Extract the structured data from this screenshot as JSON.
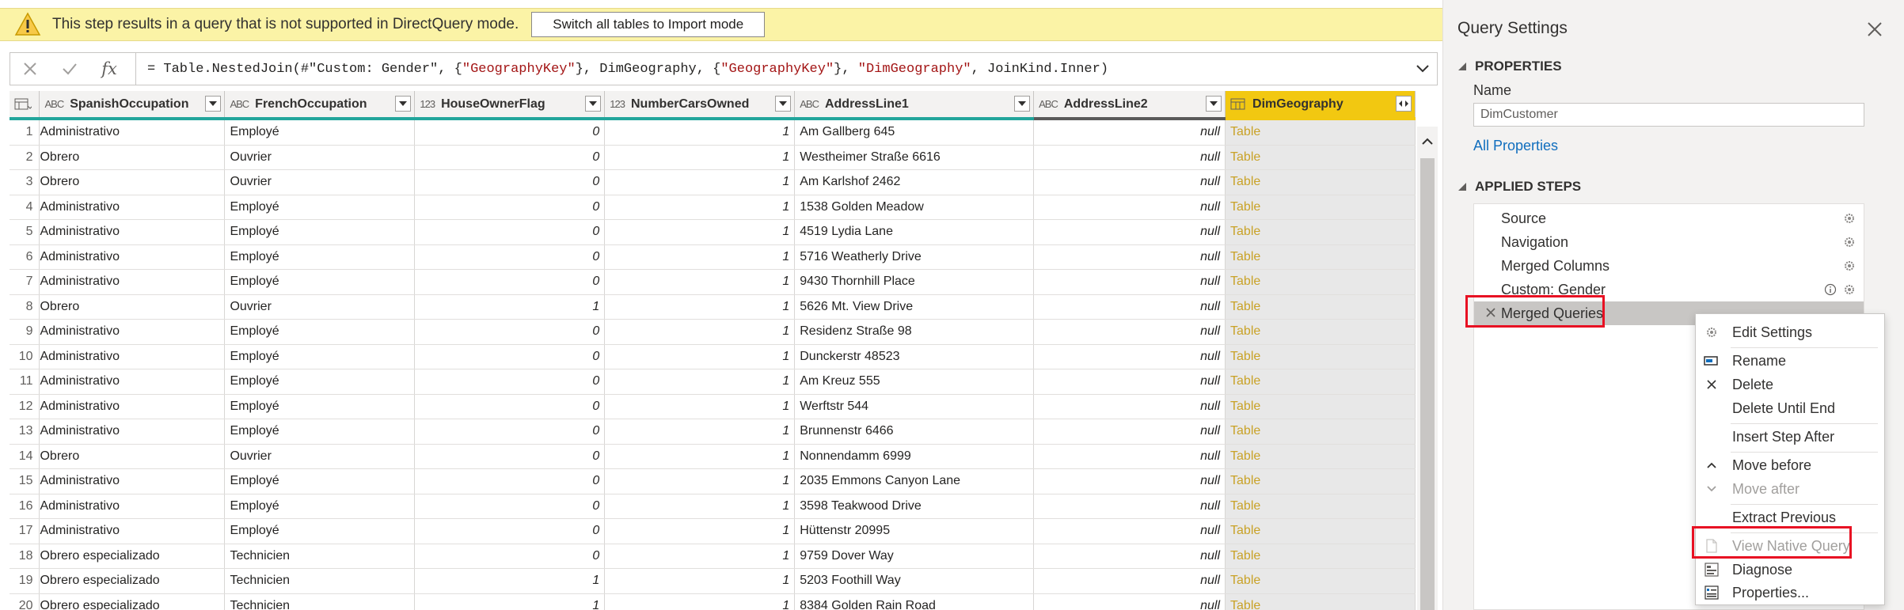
{
  "warning": {
    "message": "This step results in a query that is not supported in DirectQuery mode.",
    "button": "Switch all tables to Import mode"
  },
  "formula_bar": {
    "fx": "fx",
    "prefix": "= Table.NestedJoin(#\"Custom: Gender\", {",
    "s1": "\"GeographyKey\"",
    "mid1": "}, DimGeography, {",
    "s2": "\"GeographyKey\"",
    "mid2": "}, ",
    "s3": "\"DimGeography\"",
    "suffix": ", JoinKind.Inner)"
  },
  "columns": [
    {
      "type": "ABC",
      "name": "SpanishOccupation"
    },
    {
      "type": "ABC",
      "name": "FrenchOccupation"
    },
    {
      "type": "123",
      "name": "HouseOwnerFlag"
    },
    {
      "type": "123",
      "name": "NumberCarsOwned"
    },
    {
      "type": "ABC",
      "name": "AddressLine1"
    },
    {
      "type": "ABC",
      "name": "AddressLine2"
    },
    {
      "type": "table",
      "name": "DimGeography"
    }
  ],
  "rows": [
    {
      "n": "1",
      "sp": "Administrativo",
      "fr": "Employé",
      "ho": "0",
      "nc": "1",
      "a1": "Am Gallberg 645",
      "a2": "null",
      "dg": "Table"
    },
    {
      "n": "2",
      "sp": "Obrero",
      "fr": "Ouvrier",
      "ho": "0",
      "nc": "1",
      "a1": "Westheimer Straße 6616",
      "a2": "null",
      "dg": "Table"
    },
    {
      "n": "3",
      "sp": "Obrero",
      "fr": "Ouvrier",
      "ho": "0",
      "nc": "1",
      "a1": "Am Karlshof 2462",
      "a2": "null",
      "dg": "Table"
    },
    {
      "n": "4",
      "sp": "Administrativo",
      "fr": "Employé",
      "ho": "0",
      "nc": "1",
      "a1": "1538 Golden Meadow",
      "a2": "null",
      "dg": "Table"
    },
    {
      "n": "5",
      "sp": "Administrativo",
      "fr": "Employé",
      "ho": "0",
      "nc": "1",
      "a1": "4519 Lydia Lane",
      "a2": "null",
      "dg": "Table"
    },
    {
      "n": "6",
      "sp": "Administrativo",
      "fr": "Employé",
      "ho": "0",
      "nc": "1",
      "a1": "5716 Weatherly Drive",
      "a2": "null",
      "dg": "Table"
    },
    {
      "n": "7",
      "sp": "Administrativo",
      "fr": "Employé",
      "ho": "0",
      "nc": "1",
      "a1": "9430 Thornhill Place",
      "a2": "null",
      "dg": "Table"
    },
    {
      "n": "8",
      "sp": "Obrero",
      "fr": "Ouvrier",
      "ho": "1",
      "nc": "1",
      "a1": "5626 Mt. View Drive",
      "a2": "null",
      "dg": "Table"
    },
    {
      "n": "9",
      "sp": "Administrativo",
      "fr": "Employé",
      "ho": "0",
      "nc": "1",
      "a1": "Residenz Straße 98",
      "a2": "null",
      "dg": "Table"
    },
    {
      "n": "10",
      "sp": "Administrativo",
      "fr": "Employé",
      "ho": "0",
      "nc": "1",
      "a1": "Dunckerstr 48523",
      "a2": "null",
      "dg": "Table"
    },
    {
      "n": "11",
      "sp": "Administrativo",
      "fr": "Employé",
      "ho": "0",
      "nc": "1",
      "a1": "Am Kreuz 555",
      "a2": "null",
      "dg": "Table"
    },
    {
      "n": "12",
      "sp": "Administrativo",
      "fr": "Employé",
      "ho": "0",
      "nc": "1",
      "a1": "Werftstr 544",
      "a2": "null",
      "dg": "Table"
    },
    {
      "n": "13",
      "sp": "Administrativo",
      "fr": "Employé",
      "ho": "0",
      "nc": "1",
      "a1": "Brunnenstr 6466",
      "a2": "null",
      "dg": "Table"
    },
    {
      "n": "14",
      "sp": "Obrero",
      "fr": "Ouvrier",
      "ho": "0",
      "nc": "1",
      "a1": "Nonnendamm 6999",
      "a2": "null",
      "dg": "Table"
    },
    {
      "n": "15",
      "sp": "Administrativo",
      "fr": "Employé",
      "ho": "0",
      "nc": "1",
      "a1": "2035 Emmons Canyon Lane",
      "a2": "null",
      "dg": "Table"
    },
    {
      "n": "16",
      "sp": "Administrativo",
      "fr": "Employé",
      "ho": "0",
      "nc": "1",
      "a1": "3598 Teakwood Drive",
      "a2": "null",
      "dg": "Table"
    },
    {
      "n": "17",
      "sp": "Administrativo",
      "fr": "Employé",
      "ho": "0",
      "nc": "1",
      "a1": "Hüttenstr 20995",
      "a2": "null",
      "dg": "Table"
    },
    {
      "n": "18",
      "sp": "Obrero especializado",
      "fr": "Technicien",
      "ho": "0",
      "nc": "1",
      "a1": "9759 Dover Way",
      "a2": "null",
      "dg": "Table"
    },
    {
      "n": "19",
      "sp": "Obrero especializado",
      "fr": "Technicien",
      "ho": "1",
      "nc": "1",
      "a1": "5203 Foothill Way",
      "a2": "null",
      "dg": "Table"
    },
    {
      "n": "20",
      "sp": "Obrero especializado",
      "fr": "Technicien",
      "ho": "1",
      "nc": "1",
      "a1": "8384 Golden Rain Road",
      "a2": "null",
      "dg": "Table"
    }
  ],
  "panel": {
    "title": "Query Settings",
    "properties_header": "PROPERTIES",
    "name_label": "Name",
    "name_value": "DimCustomer",
    "all_properties": "All Properties",
    "steps_header": "APPLIED STEPS",
    "steps": [
      "Source",
      "Navigation",
      "Merged Columns",
      "Custom: Gender",
      "Merged Queries"
    ]
  },
  "context_menu": {
    "items": [
      "Edit Settings",
      "Rename",
      "Delete",
      "Delete Until End",
      "Insert Step After",
      "Move before",
      "Move after",
      "Extract Previous",
      "View Native Query",
      "Diagnose",
      "Properties..."
    ]
  },
  "colors": {
    "warning_bg": "#fbf3a6",
    "header_accent": "#22a59b",
    "selected_column": "#f2c811",
    "highlight_box": "#e81123",
    "link": "#106ebe"
  }
}
